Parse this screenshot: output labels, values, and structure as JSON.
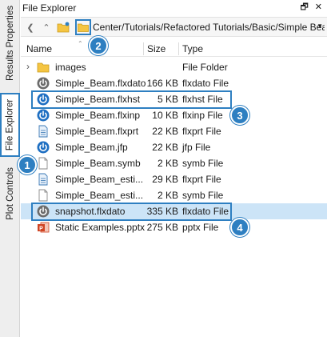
{
  "side_tabs": {
    "results_properties": "Results Properties",
    "file_explorer": "File Explorer",
    "plot_controls": "Plot Controls"
  },
  "panel": {
    "title": "File Explorer",
    "pin_icon": "pin-icon",
    "close_icon": "close-icon"
  },
  "toolbar": {
    "back_icon": "back-icon",
    "up_icon": "up-icon",
    "new_folder_icon": "new-folder-icon",
    "browse_folder_icon": "folder-icon",
    "path": "Center/Tutorials/Refactored Tutorials/Basic/Simple Beam",
    "dropdown_icon": "chevron-down-icon"
  },
  "columns": {
    "name": "Name",
    "size": "Size",
    "type": "Type"
  },
  "files": [
    {
      "name": "images",
      "size": "",
      "type": "File Folder",
      "icon": "folder-icon",
      "expandable": true,
      "selected": false
    },
    {
      "name": "Simple_Beam.flxdato",
      "size": "166 KB",
      "type": "flxdato File",
      "icon": "power-gray-icon",
      "expandable": false,
      "selected": false
    },
    {
      "name": "Simple_Beam.flxhst",
      "size": "5 KB",
      "type": "flxhst File",
      "icon": "power-blue-icon",
      "expandable": false,
      "selected": false
    },
    {
      "name": "Simple_Beam.flxinp",
      "size": "10 KB",
      "type": "flxinp File",
      "icon": "power-blue-icon",
      "expandable": false,
      "selected": false
    },
    {
      "name": "Simple_Beam.flxprt",
      "size": "22 KB",
      "type": "flxprt File",
      "icon": "document-blue-icon",
      "expandable": false,
      "selected": false
    },
    {
      "name": "Simple_Beam.jfp",
      "size": "22 KB",
      "type": "jfp File",
      "icon": "power-blue-icon",
      "expandable": false,
      "selected": false
    },
    {
      "name": "Simple_Beam.symb",
      "size": "2 KB",
      "type": "symb File",
      "icon": "document-icon",
      "expandable": false,
      "selected": false
    },
    {
      "name": "Simple_Beam_esti...",
      "size": "29 KB",
      "type": "flxprt File",
      "icon": "document-blue-icon",
      "expandable": false,
      "selected": false
    },
    {
      "name": "Simple_Beam_esti...",
      "size": "2 KB",
      "type": "symb File",
      "icon": "document-icon",
      "expandable": false,
      "selected": false
    },
    {
      "name": "snapshot.flxdato",
      "size": "335 KB",
      "type": "flxdato File",
      "icon": "power-gray-icon",
      "expandable": false,
      "selected": true
    },
    {
      "name": "Static Examples.pptx",
      "size": "275 KB",
      "type": "pptx File",
      "icon": "powerpoint-icon",
      "expandable": false,
      "selected": false
    }
  ],
  "callouts": [
    "1",
    "2",
    "3",
    "4"
  ],
  "colors": {
    "accent": "#2e7fc1",
    "selected_row": "#cce4f7",
    "folder": "#f5c542",
    "power_blue": "#1e6fc2",
    "power_gray": "#6b6b6b",
    "pptx": "#d04423"
  }
}
